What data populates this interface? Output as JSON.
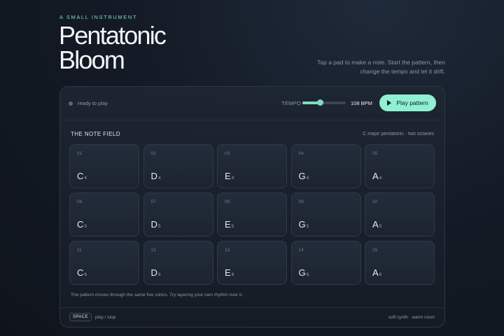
{
  "header": {
    "eyebrow": "A SMALL INSTRUMENT",
    "title_line1": "Pentatonic",
    "title_line2": "Bloom",
    "tagline": "Tap a pad to make a note. Start the pattern, then change the tempo and let it drift."
  },
  "controls": {
    "status": "ready to play",
    "tempo_label": "TEMPO",
    "tempo_level": 0.4,
    "bpm_text": "108 BPM",
    "play_label": "Play pattern",
    "accent_color": "#8ff0d2"
  },
  "field": {
    "heading": "THE NOTE FIELD",
    "meta": "C major pentatonic · two octaves",
    "pads": [
      {
        "num": "01",
        "note": "C",
        "octave": "4"
      },
      {
        "num": "02",
        "note": "D",
        "octave": "4"
      },
      {
        "num": "03",
        "note": "E",
        "octave": "4"
      },
      {
        "num": "04",
        "note": "G",
        "octave": "4"
      },
      {
        "num": "05",
        "note": "A",
        "octave": "4"
      },
      {
        "num": "06",
        "note": "C",
        "octave": "5"
      },
      {
        "num": "07",
        "note": "D",
        "octave": "5"
      },
      {
        "num": "08",
        "note": "E",
        "octave": "5"
      },
      {
        "num": "09",
        "note": "G",
        "octave": "5"
      },
      {
        "num": "10",
        "note": "A",
        "octave": "5"
      },
      {
        "num": "11",
        "note": "C",
        "octave": "6"
      },
      {
        "num": "12",
        "note": "D",
        "octave": "6"
      },
      {
        "num": "13",
        "note": "E",
        "octave": "6"
      },
      {
        "num": "14",
        "note": "G",
        "octave": "6"
      },
      {
        "num": "15",
        "note": "A",
        "octave": "6"
      }
    ],
    "hint": "The pattern moves through the same five colors. Try layering your own rhythm over it."
  },
  "footer": {
    "key": "SPACE",
    "key_action": "play / stop",
    "engine": "soft synth · warm room"
  }
}
